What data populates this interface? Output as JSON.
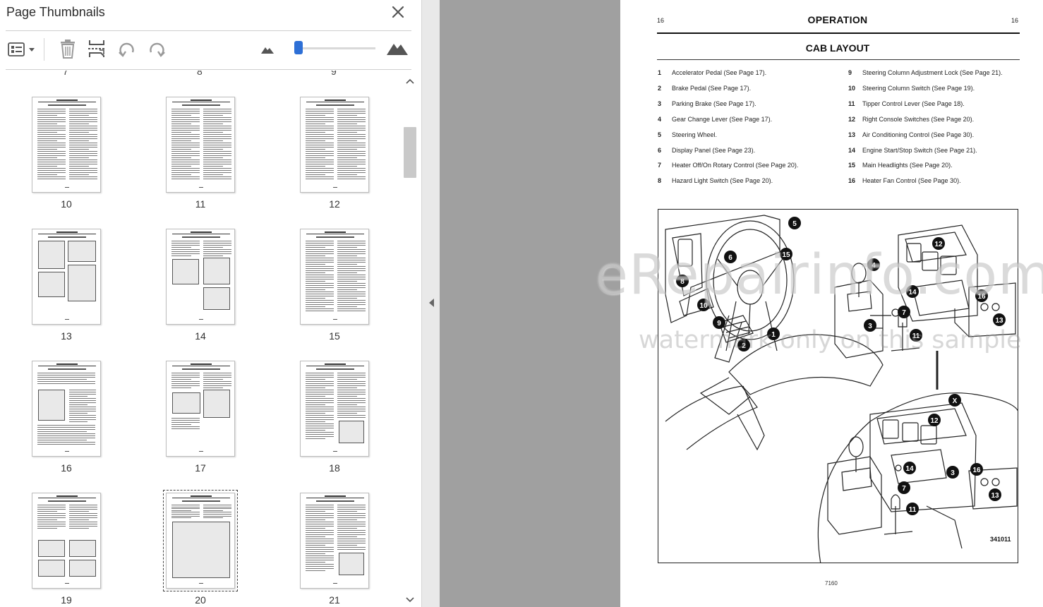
{
  "thumbnails_panel": {
    "title": "Page Thumbnails",
    "close_icon": "close-icon",
    "toolbar": {
      "options_icon": "thumbnail-options-icon",
      "delete_icon": "trash-icon",
      "insert_icon": "insert-pages-icon",
      "rotate_ccw_icon": "rotate-counterclockwise-icon",
      "rotate_cw_icon": "rotate-clockwise-icon",
      "zoom_out_icon": "small-mountain-icon",
      "zoom_in_icon": "large-mountain-icon",
      "zoom_level": 0.04
    },
    "cut_labels": [
      "7",
      "8",
      "9"
    ],
    "pages": [
      {
        "num": "10",
        "kind": "text"
      },
      {
        "num": "11",
        "kind": "text"
      },
      {
        "num": "12",
        "kind": "text"
      },
      {
        "num": "13",
        "kind": "images"
      },
      {
        "num": "14",
        "kind": "mixed"
      },
      {
        "num": "15",
        "kind": "text"
      },
      {
        "num": "16",
        "kind": "mixed-left"
      },
      {
        "num": "17",
        "kind": "mixed-mid"
      },
      {
        "num": "18",
        "kind": "text-img"
      },
      {
        "num": "19",
        "kind": "images-grid"
      },
      {
        "num": "20",
        "kind": "figure",
        "selected": true
      },
      {
        "num": "21",
        "kind": "text-img"
      }
    ]
  },
  "document": {
    "page_number_left": "16",
    "page_number_right": "16",
    "section": "OPERATION",
    "title": "CAB LAYOUT",
    "legend_left": [
      {
        "n": "1",
        "t": "Accelerator Pedal (See Page 17)."
      },
      {
        "n": "2",
        "t": "Brake Pedal (See Page 17)."
      },
      {
        "n": "3",
        "t": "Parking Brake (See Page 17)."
      },
      {
        "n": "4",
        "t": "Gear Change Lever (See Page 17)."
      },
      {
        "n": "5",
        "t": "Steering Wheel."
      },
      {
        "n": "6",
        "t": "Display Panel (See Page 23)."
      },
      {
        "n": "7",
        "t": "Heater Off/On Rotary Control (See Page 20)."
      },
      {
        "n": "8",
        "t": "Hazard Light Switch (See Page 20)."
      }
    ],
    "legend_right": [
      {
        "n": "9",
        "t": "Steering Column Adjustment Lock (See Page 21)."
      },
      {
        "n": "10",
        "t": "Steering Column Switch (See Page 19)."
      },
      {
        "n": "11",
        "t": "Tipper Control Lever (See Page 18)."
      },
      {
        "n": "12",
        "t": "Right Console Switches (See Page 20)."
      },
      {
        "n": "13",
        "t": "Air Conditioning Control (See Page 30)."
      },
      {
        "n": "14",
        "t": "Engine Start/Stop Switch (See Page 21)."
      },
      {
        "n": "15",
        "t": "Main Headlights (See Page 20)."
      },
      {
        "n": "16",
        "t": "Heater Fan Control (See Page 30)."
      }
    ],
    "figure_code": "341011",
    "figure_callouts": [
      "1",
      "2",
      "3",
      "4",
      "5",
      "6",
      "7",
      "8",
      "9",
      "10",
      "11",
      "12",
      "13",
      "14",
      "15",
      "16",
      "X",
      "12",
      "14",
      "3",
      "16",
      "13",
      "7",
      "11"
    ],
    "footer": "7160"
  },
  "watermark": {
    "line1": "eRepairinfo.com",
    "line2": "watermark only on this sample"
  }
}
